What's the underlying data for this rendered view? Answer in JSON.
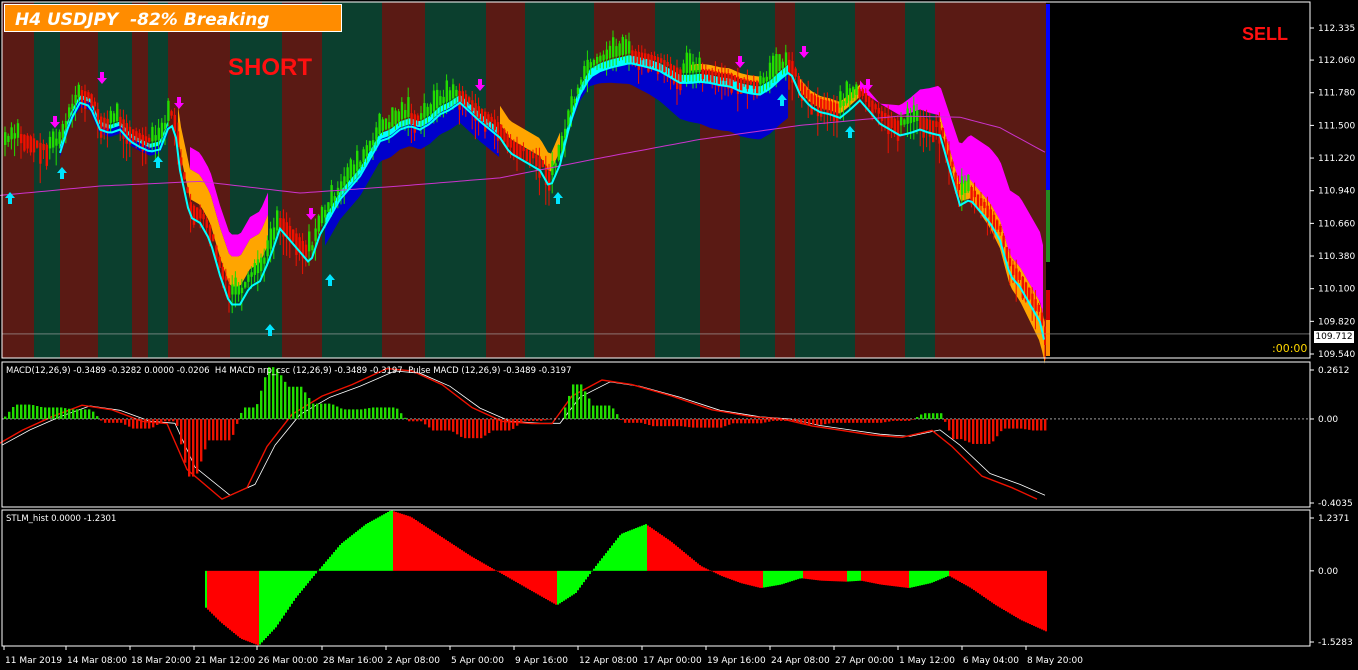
{
  "header": {
    "title": "H4 USDJPY  -82% Breaking",
    "short_label": "SHORT",
    "sell_label": "SELL",
    "timer": ":00:00",
    "current_price": "109.712"
  },
  "colors": {
    "background": "#000000",
    "zone_green": "#0b3f2e",
    "zone_red": "#5a1a14",
    "bull_candle": "#22dd00",
    "bear_candle": "#ee1100",
    "ribbon_blue": "#0000cc",
    "ribbon_cyan": "#00ffff",
    "ribbon_orange": "#ffa500",
    "ribbon_magenta": "#ff00ff",
    "ma_line": "#cc33cc",
    "arrow_up": "#00e5ff",
    "arrow_down": "#ff00ff",
    "title_bg": "#ff8c00"
  },
  "macd_panel": {
    "header": "MACD(12,26,9) -0.3489 -0.3282 0.0000 -0.0206  H4 MACD nrp_csc (12,26,9) -0.3489 -0.3197  Pulse MACD (12,26,9) -0.3489 -0.3197"
  },
  "stlm_panel": {
    "header": "STLM_hist 0.0000 -1.2301"
  },
  "chart_data": [
    {
      "type": "line",
      "title": "H4 USDJPY  -82% Breaking",
      "y_ticks": [
        "112.335",
        "112.060",
        "111.780",
        "111.500",
        "111.220",
        "110.940",
        "110.660",
        "110.380",
        "110.100",
        "109.820",
        "109.540"
      ],
      "ylim": [
        109.54,
        112.335
      ],
      "x_ticks": [
        "11 Mar 2019",
        "14 Mar 08:00",
        "18 Mar 20:00",
        "21 Mar 12:00",
        "26 Mar 00:00",
        "28 Mar 16:00",
        "2 Apr 08:00",
        "5 Apr 00:00",
        "9 Apr 16:00",
        "12 Apr 08:00",
        "17 Apr 00:00",
        "19 Apr 16:00",
        "24 Apr 08:00",
        "27 Apr 00:00",
        "1 May 12:00",
        "6 May 04:00",
        "8 May 20:00"
      ],
      "price_path": [
        [
          0,
          111.3
        ],
        [
          10,
          111.38
        ],
        [
          20,
          111.4
        ],
        [
          30,
          111.38
        ],
        [
          40,
          111.32
        ],
        [
          50,
          111.3
        ],
        [
          60,
          111.35
        ],
        [
          70,
          111.62
        ],
        [
          80,
          111.78
        ],
        [
          90,
          111.75
        ],
        [
          100,
          111.55
        ],
        [
          110,
          111.52
        ],
        [
          120,
          111.55
        ],
        [
          130,
          111.45
        ],
        [
          140,
          111.4
        ],
        [
          150,
          111.36
        ],
        [
          160,
          111.38
        ],
        [
          170,
          111.6
        ],
        [
          175,
          111.55
        ],
        [
          180,
          111.2
        ],
        [
          190,
          110.8
        ],
        [
          200,
          110.75
        ],
        [
          210,
          110.6
        ],
        [
          220,
          110.3
        ],
        [
          230,
          110.05
        ],
        [
          240,
          110.05
        ],
        [
          250,
          110.2
        ],
        [
          260,
          110.25
        ],
        [
          270,
          110.45
        ],
        [
          280,
          110.7
        ],
        [
          290,
          110.6
        ],
        [
          300,
          110.5
        ],
        [
          310,
          110.4
        ],
        [
          320,
          110.65
        ],
        [
          330,
          110.8
        ],
        [
          340,
          110.95
        ],
        [
          350,
          111.05
        ],
        [
          360,
          111.15
        ],
        [
          370,
          111.3
        ],
        [
          380,
          111.45
        ],
        [
          390,
          111.48
        ],
        [
          400,
          111.55
        ],
        [
          410,
          111.58
        ],
        [
          420,
          111.55
        ],
        [
          430,
          111.6
        ],
        [
          440,
          111.68
        ],
        [
          450,
          111.72
        ],
        [
          460,
          111.78
        ],
        [
          470,
          111.7
        ],
        [
          480,
          111.62
        ],
        [
          490,
          111.55
        ],
        [
          500,
          111.48
        ],
        [
          510,
          111.35
        ],
        [
          520,
          111.3
        ],
        [
          530,
          111.25
        ],
        [
          540,
          111.2
        ],
        [
          550,
          111.05
        ],
        [
          560,
          111.25
        ],
        [
          570,
          111.6
        ],
        [
          580,
          111.85
        ],
        [
          590,
          112.0
        ],
        [
          600,
          112.05
        ],
        [
          610,
          112.08
        ],
        [
          620,
          112.1
        ],
        [
          630,
          112.12
        ],
        [
          640,
          112.1
        ],
        [
          650,
          112.08
        ],
        [
          660,
          112.05
        ],
        [
          670,
          112.0
        ],
        [
          680,
          111.95
        ],
        [
          690,
          111.95
        ],
        [
          700,
          111.96
        ],
        [
          710,
          111.95
        ],
        [
          720,
          111.93
        ],
        [
          730,
          111.92
        ],
        [
          740,
          111.88
        ],
        [
          750,
          111.86
        ],
        [
          760,
          111.85
        ],
        [
          770,
          111.9
        ],
        [
          780,
          111.98
        ],
        [
          790,
          112.05
        ],
        [
          800,
          111.85
        ],
        [
          810,
          111.75
        ],
        [
          820,
          111.7
        ],
        [
          830,
          111.68
        ],
        [
          840,
          111.65
        ],
        [
          850,
          111.72
        ],
        [
          860,
          111.8
        ],
        [
          870,
          111.7
        ],
        [
          880,
          111.6
        ],
        [
          890,
          111.55
        ],
        [
          900,
          111.5
        ],
        [
          910,
          111.52
        ],
        [
          920,
          111.55
        ],
        [
          930,
          111.52
        ],
        [
          940,
          111.5
        ],
        [
          950,
          111.2
        ],
        [
          960,
          110.9
        ],
        [
          970,
          110.95
        ],
        [
          980,
          110.85
        ],
        [
          990,
          110.75
        ],
        [
          1000,
          110.6
        ],
        [
          1010,
          110.3
        ],
        [
          1020,
          110.2
        ],
        [
          1030,
          110.05
        ],
        [
          1040,
          109.9
        ],
        [
          1045,
          109.712
        ]
      ],
      "ma_path": [
        [
          0,
          110.9
        ],
        [
          100,
          110.98
        ],
        [
          200,
          111.02
        ],
        [
          300,
          110.92
        ],
        [
          400,
          110.98
        ],
        [
          500,
          111.05
        ],
        [
          600,
          111.22
        ],
        [
          700,
          111.38
        ],
        [
          800,
          111.5
        ],
        [
          900,
          111.58
        ],
        [
          960,
          111.57
        ],
        [
          1000,
          111.48
        ],
        [
          1045,
          111.27
        ]
      ]
    },
    {
      "type": "line",
      "title": "MACD(12,26,9) -0.3489 -0.3282 0.0000 -0.0206",
      "y_ticks": [
        "0.2612",
        "0.00",
        "-0.4035"
      ],
      "ylim": [
        -0.4035,
        0.2612
      ],
      "series": [
        {
          "name": "H4 MACD nrp_csc",
          "last": -0.3489
        },
        {
          "name": "Pulse MACD",
          "last": -0.3197
        }
      ]
    },
    {
      "type": "bar",
      "title": "STLM_hist 0.0000 -1.2301",
      "y_ticks": [
        "1.2371",
        "0.00",
        "-1.5283"
      ],
      "ylim": [
        -1.5283,
        1.2371
      ],
      "values_path": [
        [
          205,
          -0.75
        ],
        [
          220,
          -1.05
        ],
        [
          240,
          -1.38
        ],
        [
          258,
          -1.52
        ],
        [
          275,
          -1.15
        ],
        [
          295,
          -0.55
        ],
        [
          318,
          0.02
        ],
        [
          340,
          0.55
        ],
        [
          365,
          0.95
        ],
        [
          390,
          1.23
        ],
        [
          410,
          1.1
        ],
        [
          440,
          0.7
        ],
        [
          470,
          0.3
        ],
        [
          500,
          -0.05
        ],
        [
          530,
          -0.4
        ],
        [
          556,
          -0.7
        ],
        [
          575,
          -0.45
        ],
        [
          595,
          0.1
        ],
        [
          620,
          0.75
        ],
        [
          645,
          0.95
        ],
        [
          670,
          0.6
        ],
        [
          700,
          0.1
        ],
        [
          720,
          -0.1
        ],
        [
          740,
          -0.25
        ],
        [
          760,
          -0.35
        ],
        [
          780,
          -0.28
        ],
        [
          800,
          -0.15
        ],
        [
          820,
          -0.2
        ],
        [
          845,
          -0.22
        ],
        [
          860,
          -0.2
        ],
        [
          880,
          -0.28
        ],
        [
          908,
          -0.35
        ],
        [
          930,
          -0.25
        ],
        [
          948,
          -0.1
        ],
        [
          970,
          -0.35
        ],
        [
          995,
          -0.7
        ],
        [
          1020,
          -1.0
        ],
        [
          1045,
          -1.23
        ]
      ]
    }
  ]
}
